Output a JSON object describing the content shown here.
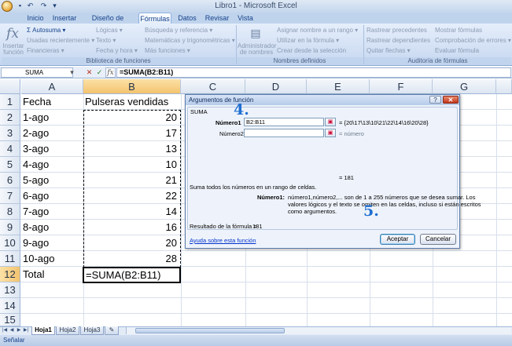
{
  "window": {
    "title": "Libro1 - Microsoft Excel"
  },
  "tabs": [
    "Inicio",
    "Insertar",
    "Diseño de página",
    "Fórmulas",
    "Datos",
    "Revisar",
    "Vista"
  ],
  "ribbon": {
    "insert_function": "Insertar función",
    "library": {
      "autosum": "Σ Autosuma ▾",
      "recent": "Usadas recientemente ▾",
      "financial": "Financieras ▾",
      "logical": "Lógicas ▾",
      "text": "Texto ▾",
      "datetime": "Fecha y hora ▾",
      "lookup": "Búsqueda y referencia ▾",
      "math": "Matemáticas y trigonométricas ▾",
      "more": "Más funciones ▾",
      "label": "Biblioteca de funciones"
    },
    "names": {
      "manager": "Administrador de nombres",
      "assign": "Asignar nombre a un rango ▾",
      "use": "Utilizar en la fórmula ▾",
      "create": "Crear desde la selección",
      "label": "Nombres definidos"
    },
    "audit": {
      "trace_prec": "Rastrear precedentes",
      "trace_dep": "Rastrear dependientes",
      "remove": "Quitar flechas ▾",
      "show": "Mostrar fórmulas",
      "check": "Comprobación de errores ▾",
      "eval": "Evaluar fórmula",
      "label": "Auditoría de fórmulas"
    }
  },
  "formula_bar": {
    "name_box": "SUMA",
    "cancel": "✕",
    "enter": "✓",
    "fx": "fx",
    "formula": "=SUMA(B2:B11)"
  },
  "columns": [
    "A",
    "B",
    "C",
    "D",
    "E",
    "F",
    "G"
  ],
  "rows": [
    "1",
    "2",
    "3",
    "4",
    "5",
    "6",
    "7",
    "8",
    "9",
    "10",
    "11",
    "12",
    "13",
    "14",
    "15"
  ],
  "sheet": {
    "header": {
      "a": "Fecha",
      "b": "Pulseras vendidas"
    },
    "dates": [
      "1-ago",
      "2-ago",
      "3-ago",
      "4-ago",
      "5-ago",
      "6-ago",
      "7-ago",
      "8-ago",
      "9-ago",
      "10-ago"
    ],
    "values": [
      "20",
      "17",
      "13",
      "10",
      "21",
      "22",
      "14",
      "16",
      "20",
      "28"
    ],
    "total_label": "Total",
    "total_formula": "=SUMA(B2:B11)"
  },
  "dialog": {
    "title": "Argumentos de función",
    "help": "?",
    "close": "✕",
    "function_name": "SUMA",
    "arg1_label": "Número1",
    "arg1_value": "B2:B11",
    "arg1_result": "= {20\\17\\13\\10\\21\\22\\14\\16\\20\\28}",
    "arg2_label": "Número2",
    "arg2_result": "= número",
    "total_result": "= 181",
    "description": "Suma todos los números en un rango de celdas.",
    "arg_help_label": "Número1:",
    "arg_help_line1": "número1,número2,... son de 1 a 255 números que se desea sumar. Los",
    "arg_help_line2": "valores lógicos y el texto se omiten en las celdas, incluso si están escritos",
    "arg_help_line3": "como argumentos.",
    "formula_result_label": "Resultado de la fórmula =",
    "formula_result_value": "181",
    "help_link": "Ayuda sobre esta función",
    "accept": "Aceptar",
    "cancel": "Cancelar"
  },
  "callouts": {
    "step4": "4.",
    "step5": "5."
  },
  "sheet_tabs": [
    "Hoja1",
    "Hoja2",
    "Hoja3"
  ],
  "status": {
    "text": "Señalar"
  }
}
